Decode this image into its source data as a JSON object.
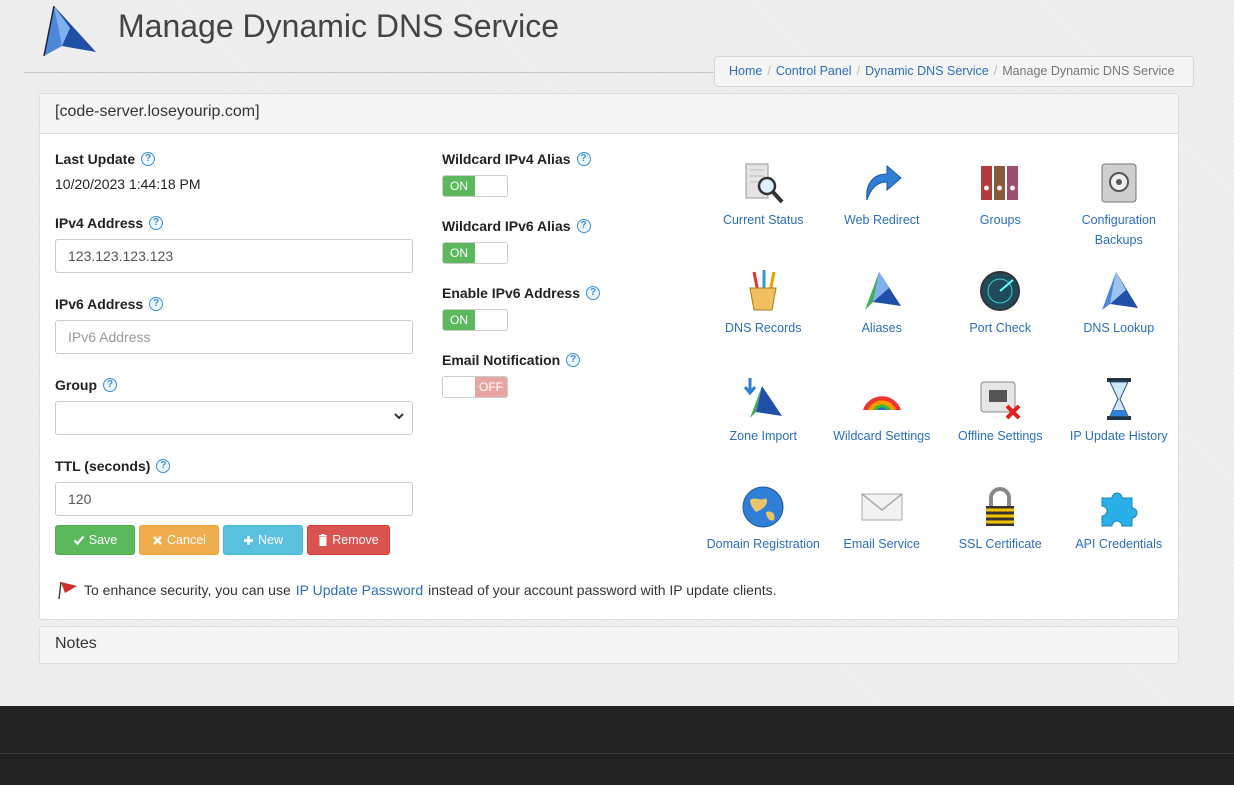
{
  "header": {
    "title": "Manage Dynamic DNS Service",
    "logo_icon": "sail-logo-icon"
  },
  "breadcrumb": {
    "items": [
      "Home",
      "Control Panel",
      "Dynamic DNS Service"
    ],
    "current": "Manage Dynamic DNS Service",
    "separator": "/"
  },
  "panel": {
    "title": "[code-server.loseyourip.com]"
  },
  "form": {
    "last_update_label": "Last Update",
    "last_update_value": "10/20/2023 1:44:18 PM",
    "ipv4_label": "IPv4 Address",
    "ipv4_value": "123.123.123.123",
    "ipv6_label": "IPv6 Address",
    "ipv6_placeholder": "IPv6 Address",
    "group_label": "Group",
    "group_value": "",
    "ttl_label": "TTL (seconds)",
    "ttl_value": "120",
    "help_glyph": "?"
  },
  "buttons": {
    "save": "Save",
    "cancel": "Cancel",
    "new": "New",
    "remove": "Remove"
  },
  "toggles": [
    {
      "label": "Wildcard IPv4 Alias",
      "state": "ON"
    },
    {
      "label": "Wildcard IPv6 Alias",
      "state": "ON"
    },
    {
      "label": "Enable IPv6 Address",
      "state": "ON"
    },
    {
      "label": "Email Notification",
      "state": "OFF"
    }
  ],
  "tools": [
    {
      "label": "Current Status",
      "icon": "current-status-icon"
    },
    {
      "label": "Web Redirect",
      "icon": "web-redirect-icon"
    },
    {
      "label": "Groups",
      "icon": "groups-icon"
    },
    {
      "label": "Configuration Backups",
      "icon": "configuration-backups-icon"
    },
    {
      "label": "DNS Records",
      "icon": "dns-records-icon"
    },
    {
      "label": "Aliases",
      "icon": "aliases-icon"
    },
    {
      "label": "Port Check",
      "icon": "port-check-icon"
    },
    {
      "label": "DNS Lookup",
      "icon": "dns-lookup-icon"
    },
    {
      "label": "Zone Import",
      "icon": "zone-import-icon"
    },
    {
      "label": "Wildcard Settings",
      "icon": "wildcard-settings-icon"
    },
    {
      "label": "Offline Settings",
      "icon": "offline-settings-icon"
    },
    {
      "label": "IP Update History",
      "icon": "ip-update-history-icon"
    },
    {
      "label": "Domain Registration",
      "icon": "domain-registration-icon"
    },
    {
      "label": "Email Service",
      "icon": "email-service-icon"
    },
    {
      "label": "SSL Certificate",
      "icon": "ssl-certificate-icon"
    },
    {
      "label": "API Credentials",
      "icon": "api-credentials-icon"
    }
  ],
  "notice": {
    "before": "To enhance security, you can use",
    "link": "IP Update Password",
    "after": "instead of your account password with IP update clients."
  },
  "notes": {
    "title": "Notes"
  },
  "colors": {
    "link": "#2a6ebb",
    "save": "#5cb85c",
    "cancel": "#f0ad4e",
    "new": "#5bc0de",
    "remove": "#d9534f",
    "toggle_on": "#5cb85c",
    "toggle_off": "#e9a5a3",
    "footer": "#222222"
  }
}
